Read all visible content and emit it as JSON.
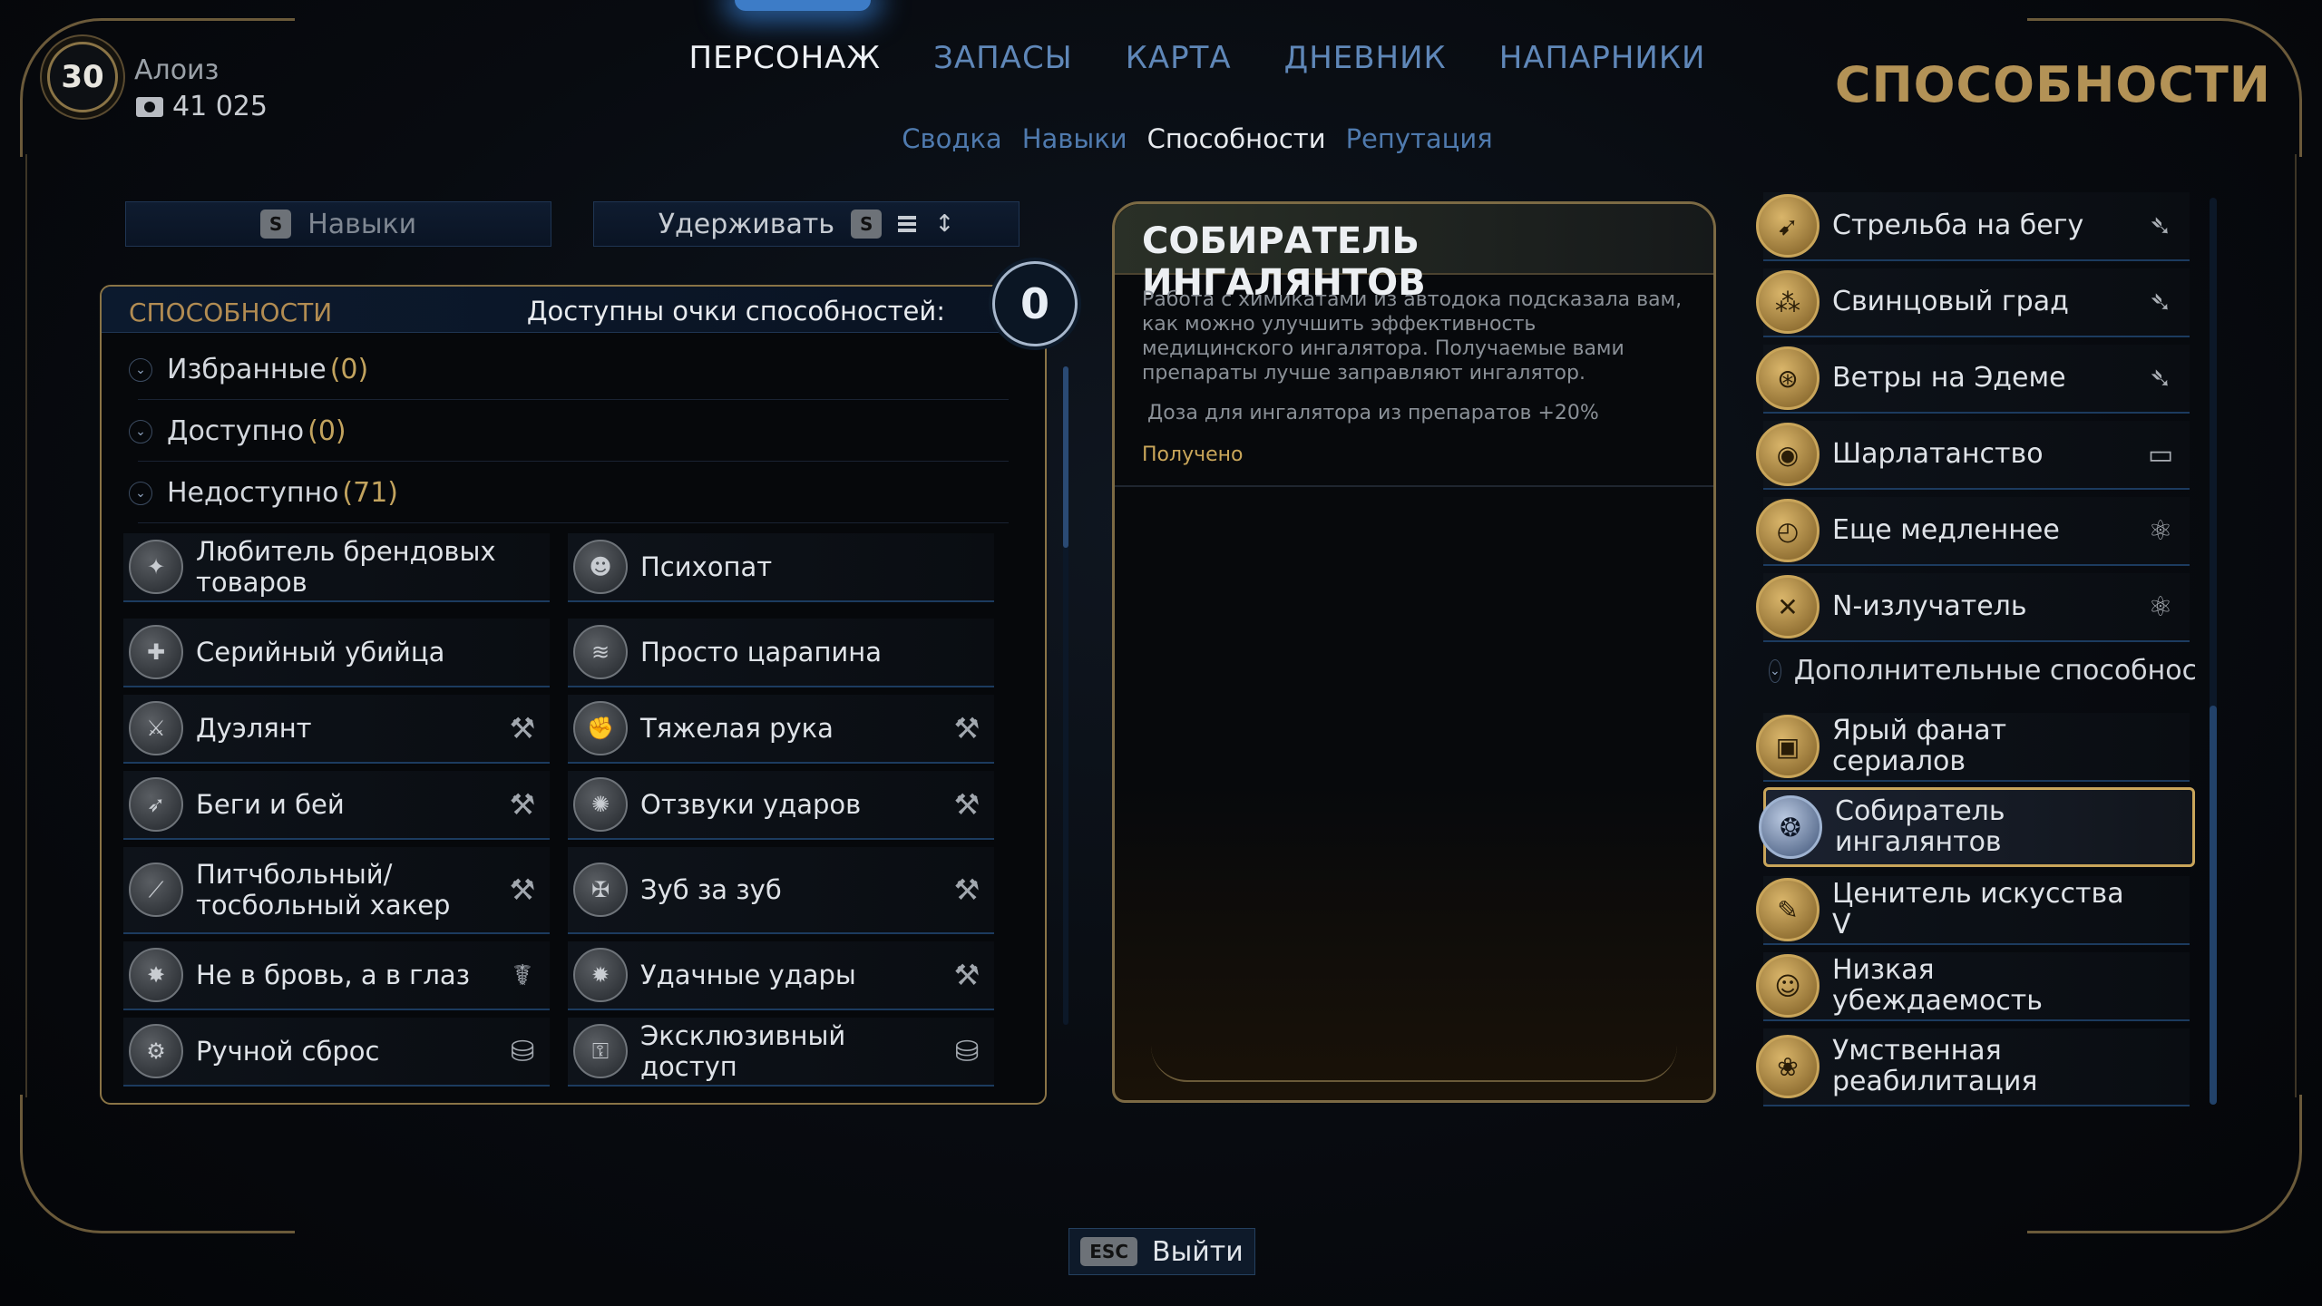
{
  "player": {
    "level": "30",
    "name": "Алоиз",
    "money": "41 025"
  },
  "nav": {
    "tabs": [
      "ПЕРСОНАЖ",
      "ЗАПАСЫ",
      "КАРТА",
      "ДНЕВНИК",
      "НАПАРНИКИ"
    ],
    "active_tab": 0,
    "subtabs": [
      "Сводка",
      "Навыки",
      "Способности",
      "Репутация"
    ],
    "active_subtab": 2
  },
  "page_heading": "СПОСОБНОСТИ",
  "controls": {
    "skills_key": "S",
    "skills_label": "Навыки",
    "hold_label": "Удерживать",
    "hold_key": "S"
  },
  "abilities_panel": {
    "title": "СПОСОБНОСТИ",
    "points_label": "Доступны очки способностей:",
    "points": "0",
    "categories": [
      {
        "label": "Избранные",
        "count": "(0)"
      },
      {
        "label": "Доступно",
        "count": "(0)"
      },
      {
        "label": "Недоступно",
        "count": "(71)"
      }
    ],
    "items": [
      {
        "name": "Любитель брендовых товаров",
        "icon": "brand-icon",
        "tag": ""
      },
      {
        "name": "Психопат",
        "icon": "psycho-icon",
        "tag": ""
      },
      {
        "name": "Серийный убийца",
        "icon": "killer-icon",
        "tag": ""
      },
      {
        "name": "Просто царапина",
        "icon": "scratch-icon",
        "tag": ""
      },
      {
        "name": "Дуэлянт",
        "icon": "duelist-icon",
        "tag": "melee"
      },
      {
        "name": "Тяжелая рука",
        "icon": "heavy-hand-icon",
        "tag": "melee"
      },
      {
        "name": "Беги и бей",
        "icon": "run-hit-icon",
        "tag": "melee"
      },
      {
        "name": "Отзвуки ударов",
        "icon": "echo-icon",
        "tag": "melee"
      },
      {
        "name": "Питчбольный/ тосбольный хакер",
        "icon": "pitchball-icon",
        "tag": "melee"
      },
      {
        "name": "Зуб за зуб",
        "icon": "tooth-icon",
        "tag": "melee"
      },
      {
        "name": "Не в бровь, а в глаз",
        "icon": "eye-hit-icon",
        "tag": "stealth"
      },
      {
        "name": "Удачные удары",
        "icon": "lucky-hit-icon",
        "tag": "melee"
      },
      {
        "name": "Ручной сброс",
        "icon": "manual-reset-icon",
        "tag": "tech"
      },
      {
        "name": "Эксклюзивный доступ",
        "icon": "exclusive-icon",
        "tag": "tech"
      }
    ]
  },
  "detail": {
    "title": "СОБИРАТЕЛЬ ИНГАЛЯНТОВ",
    "description": "Работа с химикатами из автодока подсказала вам, как можно улучшить эффективность медицинского ингалятора. Получаемые вами препараты лучше заправляют ингалятор.",
    "effect": "Доза для ингалятора из препаратов +20%",
    "status": "Получено"
  },
  "right_list": {
    "items_top": [
      {
        "name": "Стрельба на бегу",
        "icon": "run-shoot-icon",
        "tag": "ranged"
      },
      {
        "name": "Свинцовый град",
        "icon": "lead-hail-icon",
        "tag": "ranged"
      },
      {
        "name": "Ветры на Эдеме",
        "icon": "winds-icon",
        "tag": "ranged"
      },
      {
        "name": "Шарлатанство",
        "icon": "charlatan-icon",
        "tag": "dialog"
      },
      {
        "name": "Еще медленнее",
        "icon": "slower-icon",
        "tag": "science"
      },
      {
        "name": "N-излучатель",
        "icon": "n-ray-icon",
        "tag": "science"
      }
    ],
    "category": "Дополнительные способности",
    "items_bottom": [
      {
        "name": "Ярый фанат сериалов",
        "icon": "fan-icon",
        "tag": ""
      },
      {
        "name": "Собиратель ингалянтов",
        "icon": "inhaler-icon",
        "tag": ""
      },
      {
        "name": "Ценитель искусства V",
        "icon": "art-icon",
        "tag": ""
      },
      {
        "name": "Низкая убеждаемость",
        "icon": "persuasion-icon",
        "tag": ""
      },
      {
        "name": "Умственная реабилитация",
        "icon": "rehab-icon",
        "tag": ""
      }
    ],
    "selected": "Собиратель ингалянтов"
  },
  "footer": {
    "exit_key": "ESC",
    "exit_label": "Выйти"
  }
}
